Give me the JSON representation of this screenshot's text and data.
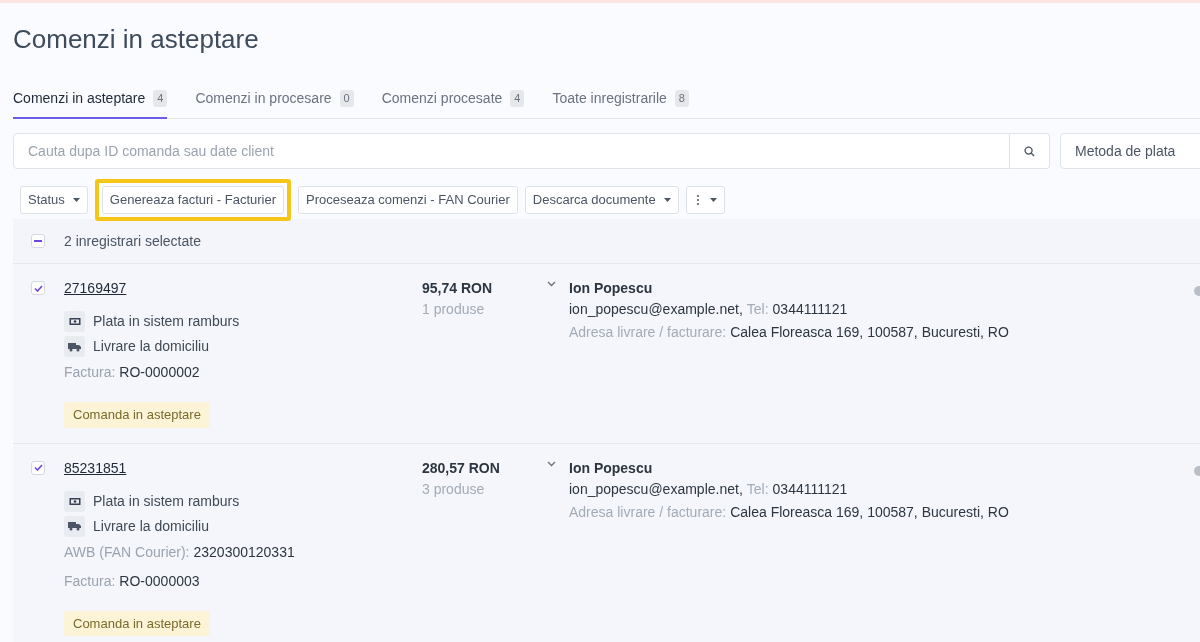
{
  "page_title": "Comenzi in asteptare",
  "tabs": [
    {
      "label": "Comenzi in asteptare",
      "count": "4",
      "selected": true
    },
    {
      "label": "Comenzi in procesare",
      "count": "0",
      "selected": false
    },
    {
      "label": "Comenzi procesate",
      "count": "4",
      "selected": false
    },
    {
      "label": "Toate inregistrarile",
      "count": "8",
      "selected": false
    }
  ],
  "search": {
    "placeholder": "Cauta dupa ID comanda sau date client"
  },
  "payment_filter": {
    "placeholder": "Metoda de plata"
  },
  "actions": [
    {
      "kind": "dropdown",
      "label": "Status",
      "highlighted": false
    },
    {
      "kind": "button",
      "label": "Genereaza facturi - Facturier",
      "highlighted": true
    },
    {
      "kind": "button",
      "label": "Proceseaza comenzi - FAN Courier",
      "highlighted": false
    },
    {
      "kind": "dropdown",
      "label": "Descarca documente",
      "highlighted": false
    },
    {
      "kind": "more",
      "highlighted": false
    }
  ],
  "selection": {
    "label": "2 inregistrari selectate",
    "partial": true
  },
  "orders": [
    {
      "id": "27169497",
      "checked": true,
      "payment": "Plata in sistem ramburs",
      "delivery": "Livrare la domiciliu",
      "details": [
        {
          "label": "Factura:",
          "value": "RO-0000002"
        }
      ],
      "status": "Comanda in asteptare",
      "total": "95,74 RON",
      "products": "1 produse",
      "customer": "Ion Popescu",
      "email": "ion_popescu@example.net,",
      "phone_label": "Tel:",
      "phone": "0344111121",
      "address_label": "Adresa livrare / facturare:",
      "address": "Calea Floreasca 169, 100587, Bucuresti, RO"
    },
    {
      "id": "85231851",
      "checked": true,
      "payment": "Plata in sistem ramburs",
      "delivery": "Livrare la domiciliu",
      "details": [
        {
          "label": "AWB (FAN Courier):",
          "value": "2320300120331"
        },
        {
          "label": "Factura:",
          "value": "RO-0000003"
        }
      ],
      "status": "Comanda in asteptare",
      "total": "280,57 RON",
      "products": "3 produse",
      "customer": "Ion Popescu",
      "email": "ion_popescu@example.net,",
      "phone_label": "Tel:",
      "phone": "0344111121",
      "address_label": "Adresa livrare / facturare:",
      "address": "Calea Floreasca 169, 100587, Bucuresti, RO"
    }
  ]
}
